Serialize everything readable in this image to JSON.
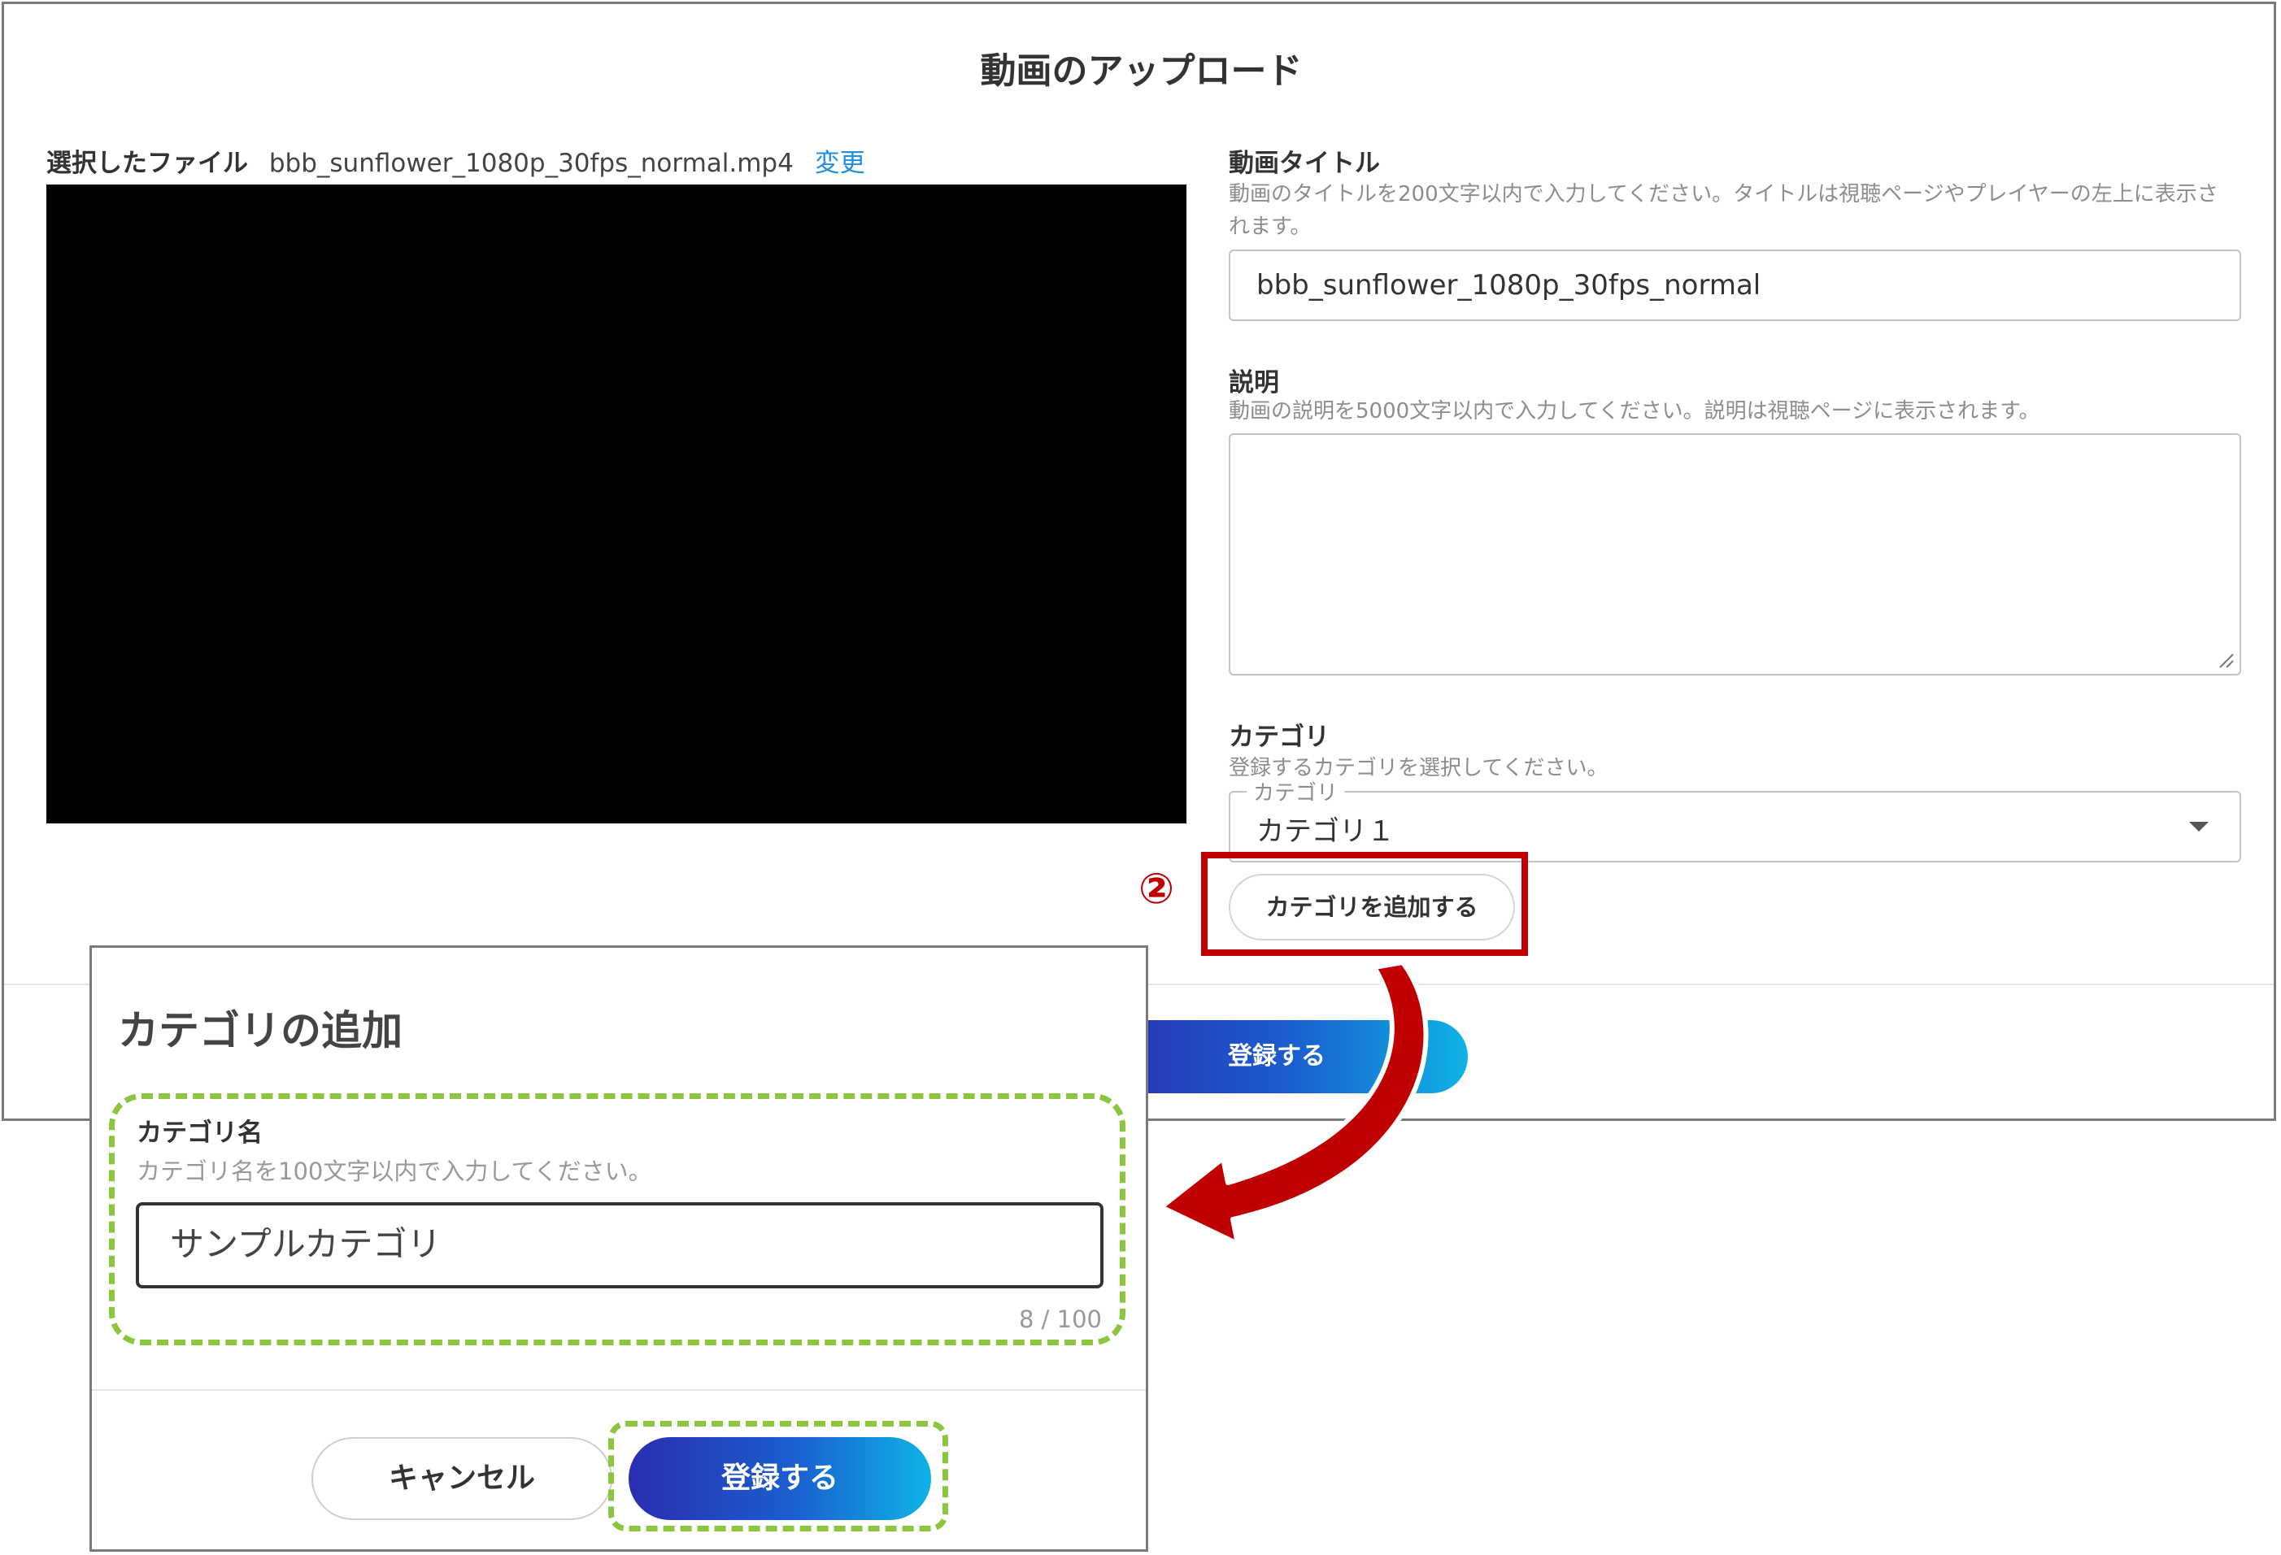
{
  "upload_dialog": {
    "title": "動画のアップロード",
    "selected_file_label": "選択したファイル",
    "file_name": "bbb_sunflower_1080p_30fps_normal.mp4",
    "change_link": "変更",
    "video_title": {
      "label": "動画タイトル",
      "help": "動画のタイトルを200文字以内で入力してください。タイトルは視聴ページやプレイヤーの左上に表示されます。",
      "value": "bbb_sunflower_1080p_30fps_normal"
    },
    "description": {
      "label": "説明",
      "help": "動画の説明を5000文字以内で入力してください。説明は視聴ページに表示されます。",
      "value": ""
    },
    "category": {
      "label": "カテゴリ",
      "help": "登録するカテゴリを選択してください。",
      "select_legend": "カテゴリ",
      "selected": "カテゴリ１"
    },
    "add_category_button": "カテゴリを追加する",
    "register_button": "登録する"
  },
  "annotation": {
    "step_number": "②",
    "color_red": "#c00000",
    "color_green": "#8cc63f"
  },
  "add_category_modal": {
    "title": "カテゴリの追加",
    "field_label": "カテゴリ名",
    "field_help": "カテゴリ名を100文字以内で入力してください。",
    "field_value": "サンプルカテゴリ",
    "char_count": "8 / 100",
    "cancel_button": "キャンセル",
    "register_button": "登録する"
  },
  "colors": {
    "link": "#1e8fe6",
    "gradient_start": "#2b2db0",
    "gradient_end": "#0fb3e6"
  },
  "icons": {
    "dropdown": "chevron-down-icon",
    "resize": "resize-handle-icon",
    "arrow": "curved-arrow-icon"
  }
}
